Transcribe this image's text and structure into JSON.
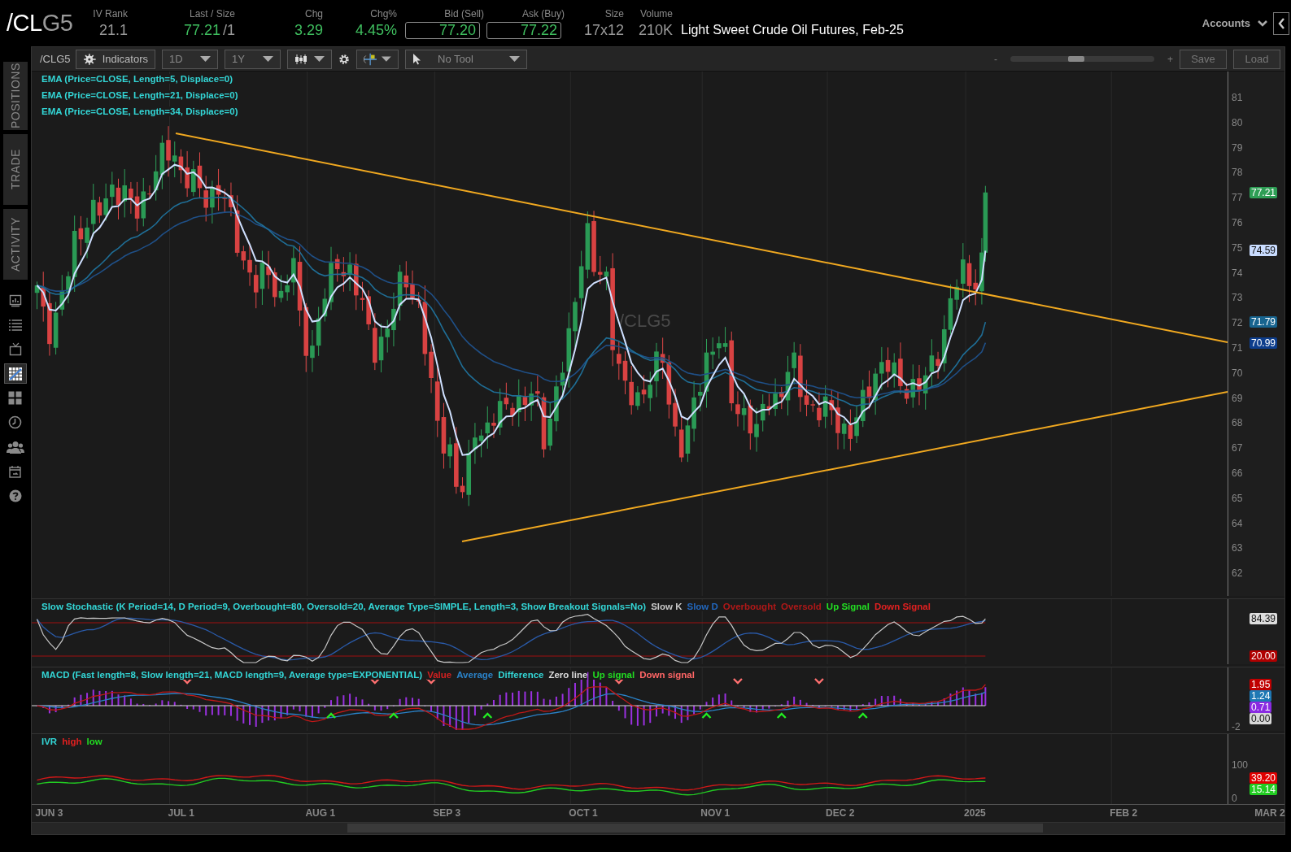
{
  "header": {
    "symbol": {
      "root": "/CL",
      "contract": "G5"
    },
    "quotes": [
      {
        "label": "IV Rank",
        "value": "21.1",
        "positive": false,
        "kind": "plain"
      },
      {
        "label": "Last / Size",
        "value": "77.21",
        "size": "/1",
        "positive": true,
        "kind": "plain"
      },
      {
        "label": "Chg",
        "value": "3.29",
        "positive": true,
        "kind": "plain"
      },
      {
        "label": "Chg%",
        "value": "4.45%",
        "positive": true,
        "kind": "plain"
      },
      {
        "label": "Bid (Sell)",
        "value": "77.20",
        "positive": true,
        "kind": "boxed"
      },
      {
        "label": "Ask (Buy)",
        "value": "77.22",
        "positive": true,
        "kind": "boxed"
      },
      {
        "label": "Size",
        "value": "17x12",
        "positive": false,
        "kind": "plain"
      },
      {
        "label": "Volume",
        "value": "210K",
        "positive": false,
        "kind": "plain"
      }
    ],
    "description": "Light Sweet Crude Oil Futures, Feb-25",
    "accounts": "Accounts"
  },
  "sidebar": {
    "tabs": [
      {
        "label": "POSITIONS",
        "selected": false
      },
      {
        "label": "TRADE",
        "selected": false
      },
      {
        "label": "ACTIVITY",
        "selected": false
      }
    ],
    "tools": [
      {
        "kind": "monitor",
        "selected": false
      },
      {
        "kind": "list",
        "selected": false
      },
      {
        "kind": "tv",
        "selected": false
      },
      {
        "kind": "chart",
        "selected": true
      },
      {
        "kind": "grid",
        "selected": false
      },
      {
        "kind": "history",
        "selected": false
      },
      {
        "kind": "people",
        "selected": false
      },
      {
        "kind": "calendar",
        "selected": false
      },
      {
        "kind": "help",
        "selected": false
      }
    ]
  },
  "toolbar": {
    "symbol": "/CLG5",
    "indicators": "Indicators",
    "aggregation": "1D",
    "range": "1Y",
    "drawing_tool": "No Tool",
    "zoom": {
      "minus": "-",
      "plus": "+",
      "level": 0.46
    },
    "buttons": [
      "Save",
      "Load"
    ]
  },
  "price_pane": {
    "studies": [
      "EMA (Price=CLOSE, Length=5, Displace=0)",
      "EMA (Price=CLOSE, Length=21, Displace=0)",
      "EMA (Price=CLOSE, Length=34, Displace=0)"
    ],
    "symbol_label": "/CLG5",
    "ticks": [
      "81",
      "80",
      "79",
      "78",
      "77",
      "76",
      "75",
      "74",
      "73",
      "72",
      "71",
      "70",
      "69",
      "68",
      "67",
      "66",
      "65",
      "64",
      "63",
      "62"
    ],
    "badges": [
      {
        "text": "77.21",
        "kind": "last",
        "color": "#2e9e55"
      },
      {
        "text": "74.59",
        "kind": "ema5",
        "color": "#c9dcff"
      },
      {
        "text": "71.79",
        "kind": "ema21",
        "color": "#17648f"
      },
      {
        "text": "70.99",
        "kind": "ema34",
        "color": "#0d3d8c"
      }
    ]
  },
  "stochastic_pane": {
    "legend": [
      {
        "text": "Slow Stochastic (K Period=14, D Period=9, Overbought=80, Oversold=20, Average Type=SIMPLE, Length=3, Show Breakout Signals=No)",
        "color": "#33d6d6"
      },
      {
        "text": "Slow K",
        "color": "#c8c8c8"
      },
      {
        "text": "Slow D",
        "color": "#2266bb"
      },
      {
        "text": "Overbought",
        "color": "#b01818"
      },
      {
        "text": "Oversold",
        "color": "#b01818"
      },
      {
        "text": "Up Signal",
        "color": "#22dd22"
      },
      {
        "text": "Down Signal",
        "color": "#e02020"
      }
    ],
    "badges": [
      {
        "text": "84.39",
        "kind": "slow_k",
        "color": "#dddddd"
      },
      {
        "text": "20.00",
        "kind": "oversold",
        "color": "#b00000"
      }
    ]
  },
  "macd_pane": {
    "legend": [
      {
        "text": "MACD (Fast length=8, Slow length=21, MACD length=9, Average type=EXPONENTIAL)",
        "color": "#33d6d6"
      },
      {
        "text": "Value",
        "color": "#d02020"
      },
      {
        "text": "Average",
        "color": "#2a82c8"
      },
      {
        "text": "Difference",
        "color": "#33d6d6"
      },
      {
        "text": "Zero line",
        "color": "#dddddd"
      },
      {
        "text": "Up signal",
        "color": "#22dd22"
      },
      {
        "text": "Down signal",
        "color": "#ff6666"
      }
    ],
    "ticks": [
      "-2"
    ],
    "badges": [
      {
        "text": "1.95",
        "kind": "value",
        "color": "#c00000"
      },
      {
        "text": "1.24",
        "kind": "average",
        "color": "#1e78b4"
      },
      {
        "text": "0.71",
        "kind": "difference",
        "color": "#8a2be2"
      },
      {
        "text": "0.00",
        "kind": "zero",
        "color": "#d8d8d8"
      }
    ]
  },
  "ivr_pane": {
    "legend": [
      {
        "text": "IVR",
        "color": "#33d6d6"
      },
      {
        "text": "high",
        "color": "#e02020"
      },
      {
        "text": "low",
        "color": "#22dd22"
      }
    ],
    "ticks": [
      "100",
      "0"
    ],
    "badges": [
      {
        "text": "39.20",
        "kind": "high",
        "color": "#e00000"
      },
      {
        "text": "15.14",
        "kind": "low",
        "color": "#22cc22"
      }
    ]
  },
  "time_axis": [
    "JUN 3",
    "JUL 1",
    "AUG 1",
    "SEP 3",
    "OCT 1",
    "NOV 1",
    "DEC 2",
    "2025",
    "FEB 2",
    "MAR 2"
  ]
}
